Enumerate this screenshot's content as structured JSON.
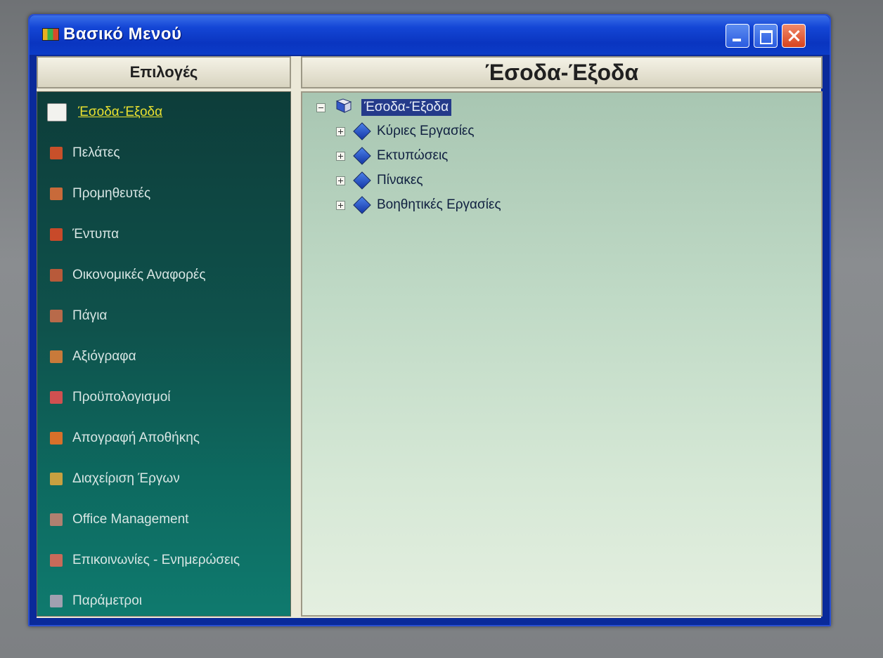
{
  "window": {
    "title": "Βασικό Μενού",
    "icon": "app-menu-icon",
    "controls": [
      "minimize-icon",
      "maximize-icon",
      "close-icon"
    ]
  },
  "left_panel": {
    "header": "Επιλογές",
    "items": [
      {
        "label": "Έσοδα-Έξοδα",
        "icon": "income-expense-icon",
        "active": true,
        "color": "#f2f2ee"
      },
      {
        "label": "Πελάτες",
        "icon": "customers-icon",
        "color": "#c8502a"
      },
      {
        "label": "Προμηθευτές",
        "icon": "suppliers-icon",
        "color": "#c86a3a"
      },
      {
        "label": "Έντυπα",
        "icon": "forms-icon",
        "color": "#c84a2a"
      },
      {
        "label": "Οικονομικές Αναφορές",
        "icon": "financial-reports-icon",
        "color": "#b85a3a"
      },
      {
        "label": "Πάγια",
        "icon": "fixed-assets-icon",
        "color": "#b86a4a"
      },
      {
        "label": "Αξιόγραφα",
        "icon": "securities-icon",
        "color": "#c87a3a"
      },
      {
        "label": "Προϋπολογισμοί",
        "icon": "budgets-icon",
        "color": "#d05050"
      },
      {
        "label": "Απογραφή Αποθήκης",
        "icon": "inventory-icon",
        "color": "#d8702a"
      },
      {
        "label": "Διαχείριση Έργων",
        "icon": "projects-icon",
        "color": "#c8a040"
      },
      {
        "label": "Office Management",
        "icon": "office-management-icon",
        "color": "#b08070"
      },
      {
        "label": "Επικοινωνίες - Ενημερώσεις",
        "icon": "communications-icon",
        "color": "#c86a5a"
      },
      {
        "label": "Παράμετροι",
        "icon": "parameters-icon",
        "color": "#a0a0b0"
      }
    ]
  },
  "right_panel": {
    "header": "Έσοδα-Έξοδα",
    "tree": {
      "root": {
        "label": "Έσοδα-Έξοδα",
        "icon": "book-icon",
        "expanded": true
      },
      "children": [
        {
          "label": "Κύριες Εργασίες",
          "icon": "diamond-icon"
        },
        {
          "label": "Εκτυπώσεις",
          "icon": "diamond-icon"
        },
        {
          "label": "Πίνακες",
          "icon": "diamond-icon"
        },
        {
          "label": "Βοηθητικές Εργασίες",
          "icon": "diamond-icon"
        }
      ]
    }
  }
}
